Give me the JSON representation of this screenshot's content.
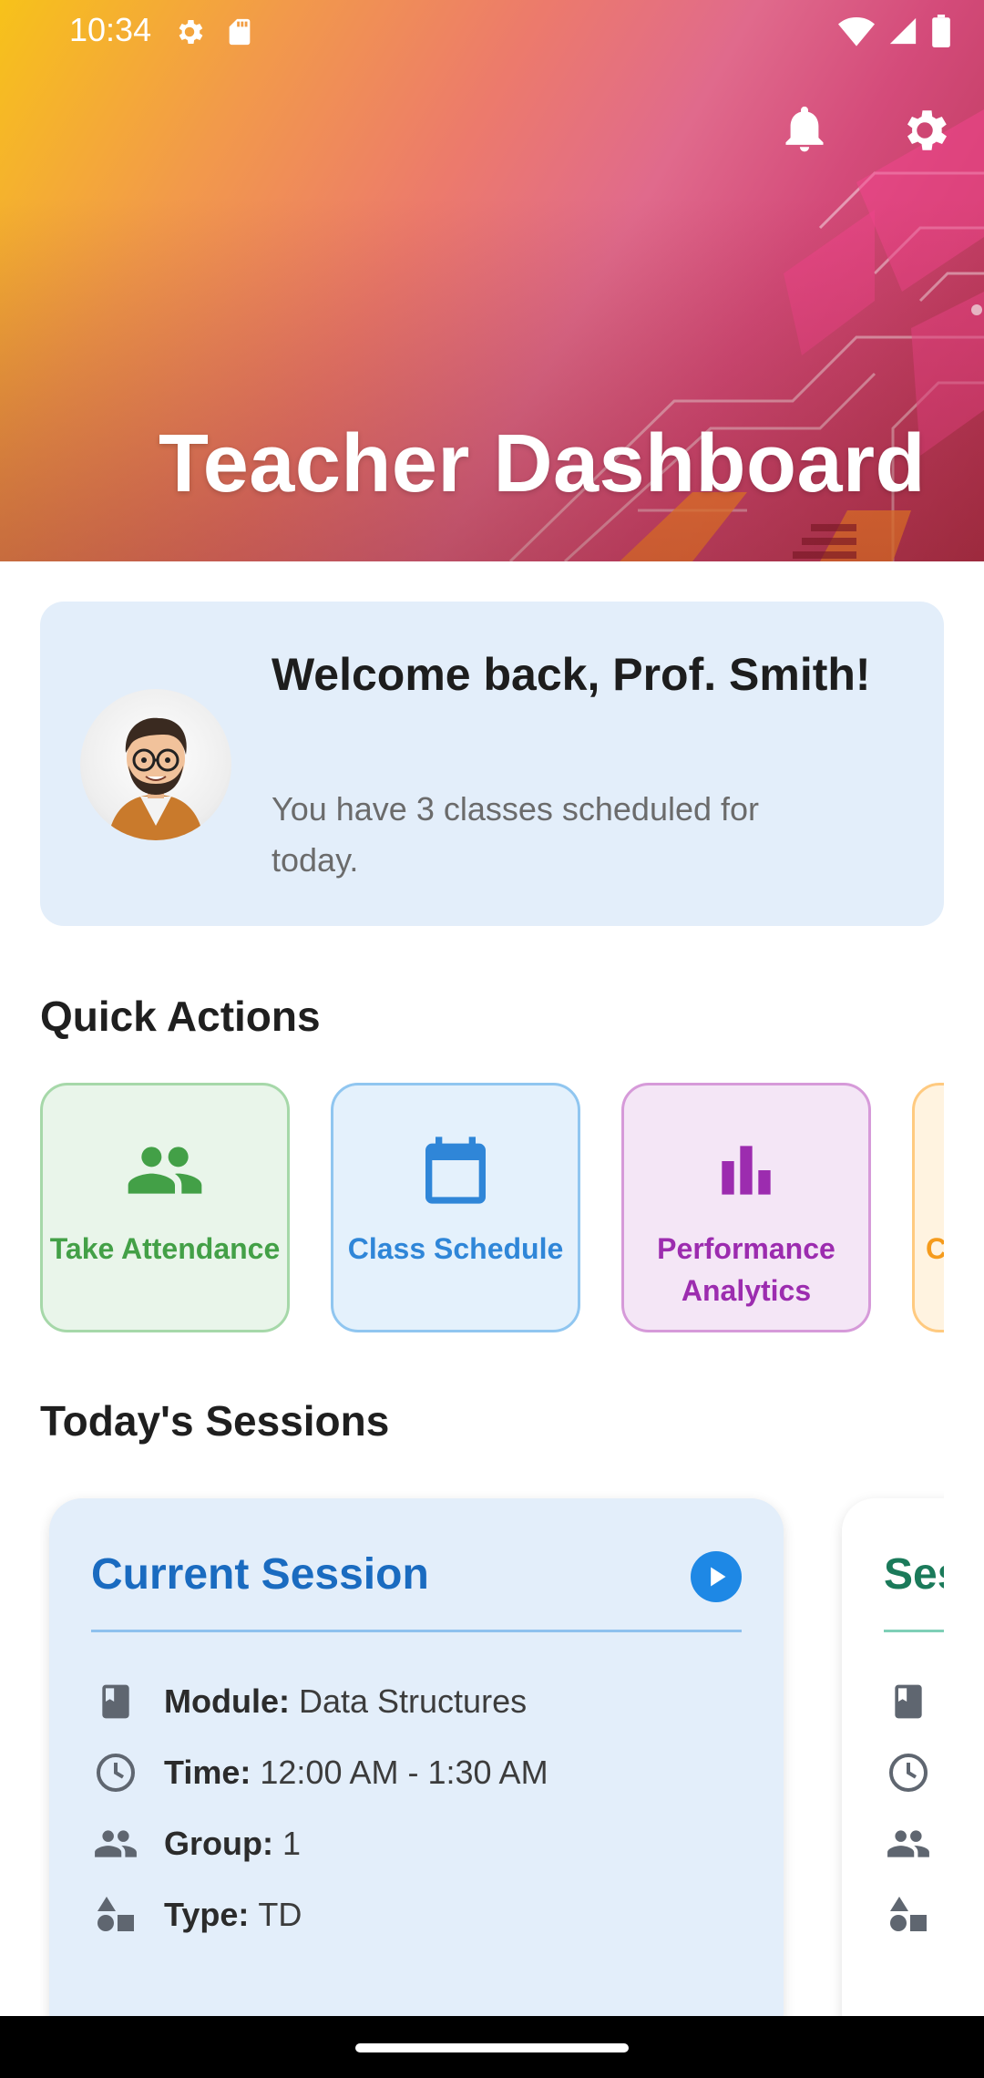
{
  "status_bar": {
    "time": "10:34",
    "icons_left": [
      "settings-gear-icon",
      "sd-card-icon"
    ],
    "icons_right": [
      "wifi-icon",
      "cellular-signal-icon",
      "battery-icon"
    ]
  },
  "header": {
    "title": "Teacher Dashboard",
    "actions": [
      "notifications-bell-icon",
      "settings-gear-icon"
    ]
  },
  "welcome": {
    "title": "Welcome back, Prof. Smith!",
    "subtitle": "You have 3 classes scheduled for today."
  },
  "quick_actions": {
    "title": "Quick Actions",
    "items": [
      {
        "label": "Take Attendance",
        "icon": "group-icon",
        "color": "#43a047"
      },
      {
        "label": "Class Schedule",
        "icon": "calendar-icon",
        "color": "#2f86d8"
      },
      {
        "label": "Performance Analytics",
        "icon": "bar-chart-icon",
        "color": "#9c2caf"
      },
      {
        "label": "C",
        "icon": "unknown",
        "color": "#f59b1c"
      }
    ]
  },
  "sessions": {
    "title": "Today's Sessions",
    "cards": [
      {
        "title": "Current Session",
        "module_label": "Module:",
        "module": "Data Structures",
        "time_label": "Time:",
        "time": "12:00 AM - 1:30 AM",
        "group_label": "Group:",
        "group": "1",
        "type_label": "Type:",
        "type": "TD"
      },
      {
        "title": "Ses"
      }
    ]
  },
  "colors": {
    "accent_blue": "#1a6bc0",
    "card_bg": "#e3eefa"
  }
}
